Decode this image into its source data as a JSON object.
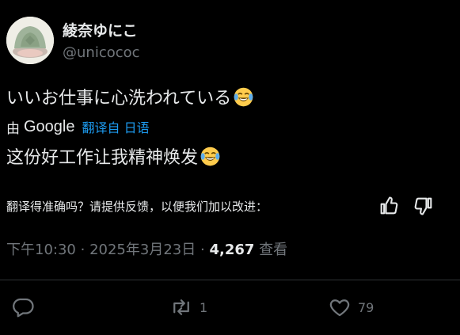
{
  "author": {
    "display_name": "綾奈ゆにこ",
    "handle": "@unicococ"
  },
  "tweet": {
    "original_text": "いいお仕事に心洗われている",
    "translated_by_prefix": "由",
    "translated_by_brand": "Google",
    "translated_from": "翻译自 日语",
    "translated_text": "这份好工作让我精神焕发",
    "emoji": "face-with-tears-of-joy"
  },
  "feedback": {
    "prompt": "翻译得准确吗？请提供反馈，以便我们加以改进："
  },
  "meta": {
    "time": "下午10:30",
    "separator": "·",
    "date": "2025年3月23日",
    "views_count": "4,267",
    "views_label": "查看"
  },
  "actions": {
    "reply_count": "",
    "retweet_count": "1",
    "like_count": "79"
  },
  "colors": {
    "background": "#000000",
    "text": "#e7e9ea",
    "muted": "#71767b",
    "link": "#1d9bf0",
    "divider": "#2f3336"
  }
}
